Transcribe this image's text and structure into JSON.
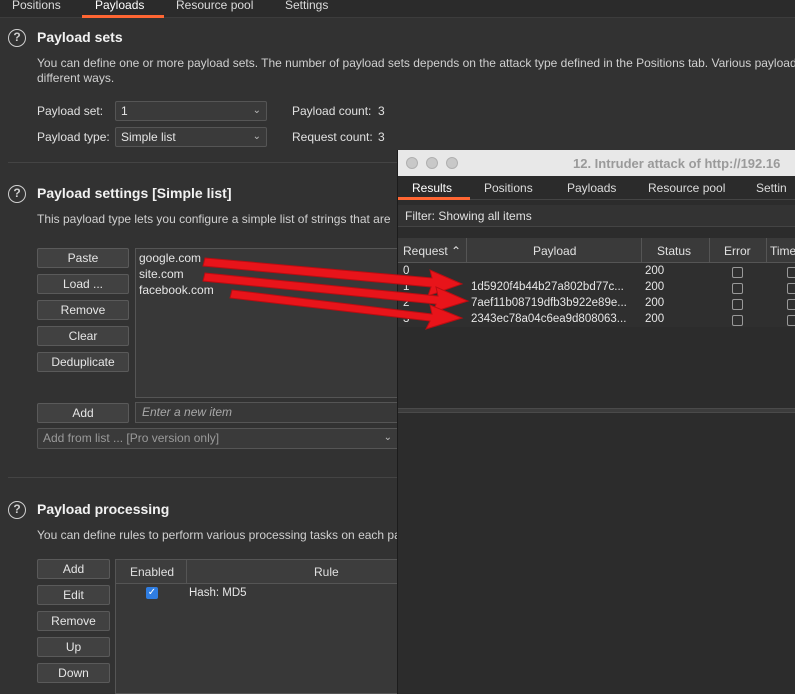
{
  "top_tabs": [
    "Positions",
    "Payloads",
    "Resource pool",
    "Settings"
  ],
  "payload_sets": {
    "title": "Payload sets",
    "description": "You can define one or more payload sets. The number of payload sets depends on the attack type defined in the Positions tab. Various payload",
    "description2": "different ways.",
    "set_label": "Payload set:",
    "set_value": "1",
    "type_label": "Payload type:",
    "type_value": "Simple list",
    "count_label": "Payload count:",
    "count_value": "3",
    "request_label": "Request count:",
    "request_value": "3"
  },
  "payload_settings": {
    "title": "Payload settings [Simple list]",
    "description": "This payload type lets you configure a simple list of strings that are",
    "buttons": [
      "Paste",
      "Load ...",
      "Remove",
      "Clear",
      "Deduplicate"
    ],
    "items": [
      "google.com",
      "site.com",
      "facebook.com"
    ],
    "add_label": "Add",
    "add_placeholder": "Enter a new item",
    "add_from_list": "Add from list ... [Pro version only]"
  },
  "payload_processing": {
    "title": "Payload processing",
    "description": "You can define rules to perform various processing tasks on each pa",
    "buttons": [
      "Add",
      "Edit",
      "Remove",
      "Up",
      "Down"
    ],
    "col_enabled": "Enabled",
    "col_rule": "Rule",
    "rule": "Hash: MD5"
  },
  "attack_window": {
    "title": "12. Intruder attack of http://192.16",
    "tabs": [
      "Results",
      "Positions",
      "Payloads",
      "Resource pool",
      "Settin"
    ],
    "filter": "Filter: Showing all items",
    "columns": [
      "Request",
      "Payload",
      "Status",
      "Error",
      "Time"
    ],
    "rows": [
      {
        "request": "0",
        "payload": "",
        "status": "200"
      },
      {
        "request": "1",
        "payload": "1d5920f4b44b27a802bd77c...",
        "status": "200"
      },
      {
        "request": "2",
        "payload": "7aef11b08719dfb3b922e89e...",
        "status": "200"
      },
      {
        "request": "3",
        "payload": "2343ec78a04c6ea9d808063...",
        "status": "200"
      }
    ]
  },
  "colors": {
    "accent": "#ff6633",
    "arrow": "#e8141a",
    "checkbox": "#2f7de1"
  }
}
